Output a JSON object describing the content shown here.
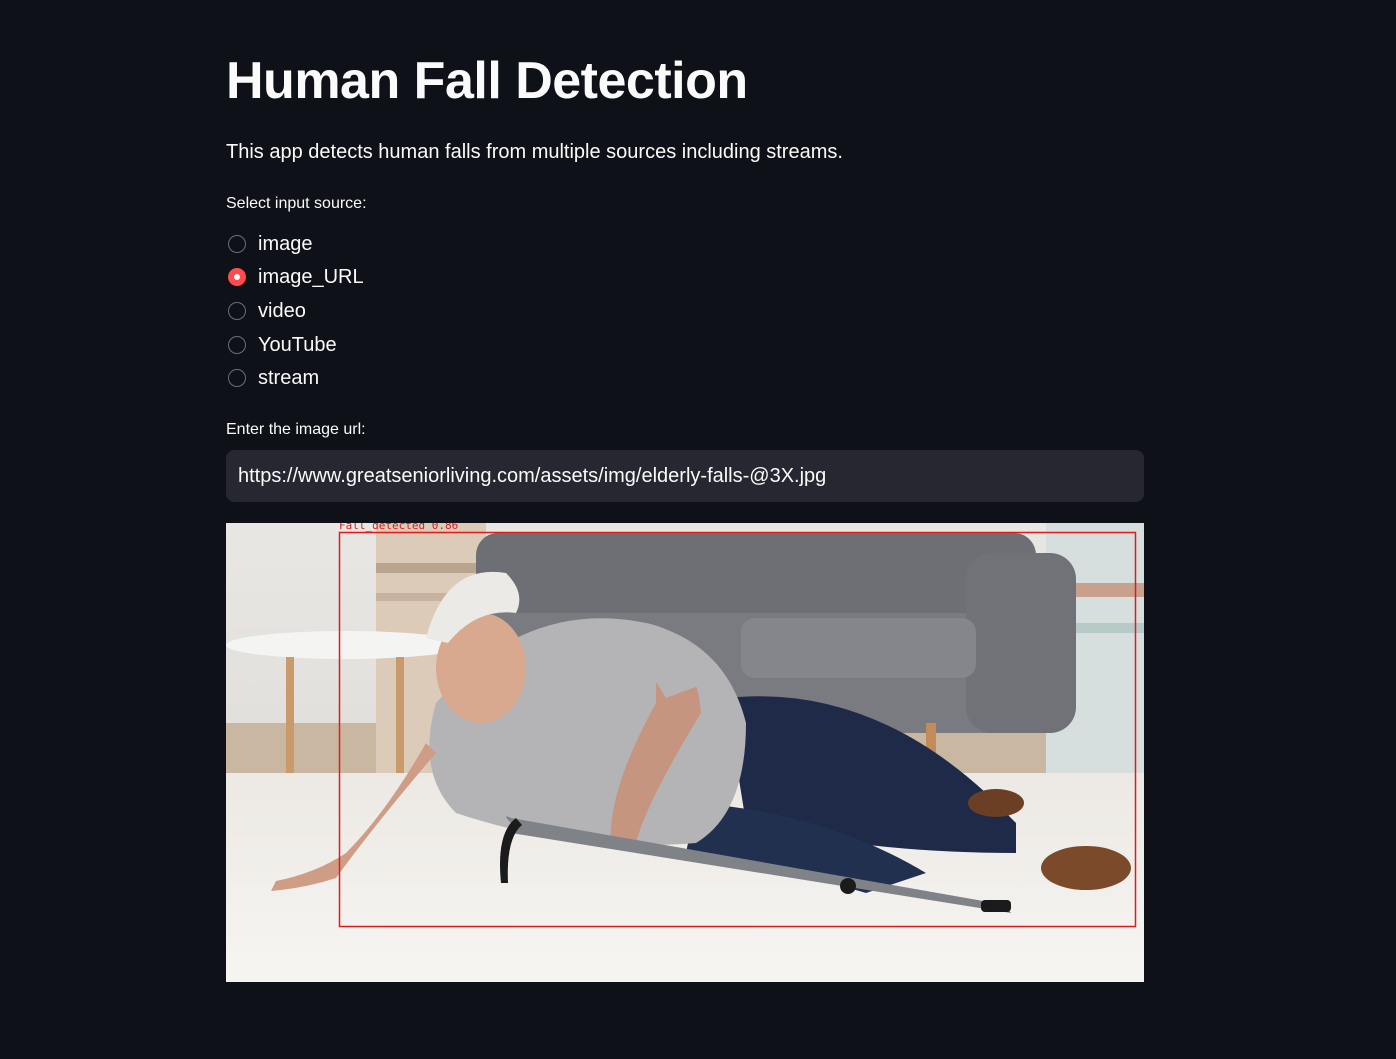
{
  "header": {
    "title": "Human Fall Detection",
    "description": "This app detects human falls from multiple sources including streams."
  },
  "source_select": {
    "label": "Select input source:",
    "options": [
      "image",
      "image_URL",
      "video",
      "YouTube",
      "stream"
    ],
    "selected": "image_URL"
  },
  "url_input": {
    "label": "Enter the image url:",
    "value": "https://www.greatseniorliving.com/assets/img/elderly-falls-@3X.jpg"
  },
  "result": {
    "detection_label": "Fall_detected 0.86",
    "box_color": "#e11b1b"
  },
  "colors": {
    "background": "#0e1117",
    "accent": "#ff4b4b",
    "input_bg": "#262730",
    "text": "#fafafa"
  }
}
